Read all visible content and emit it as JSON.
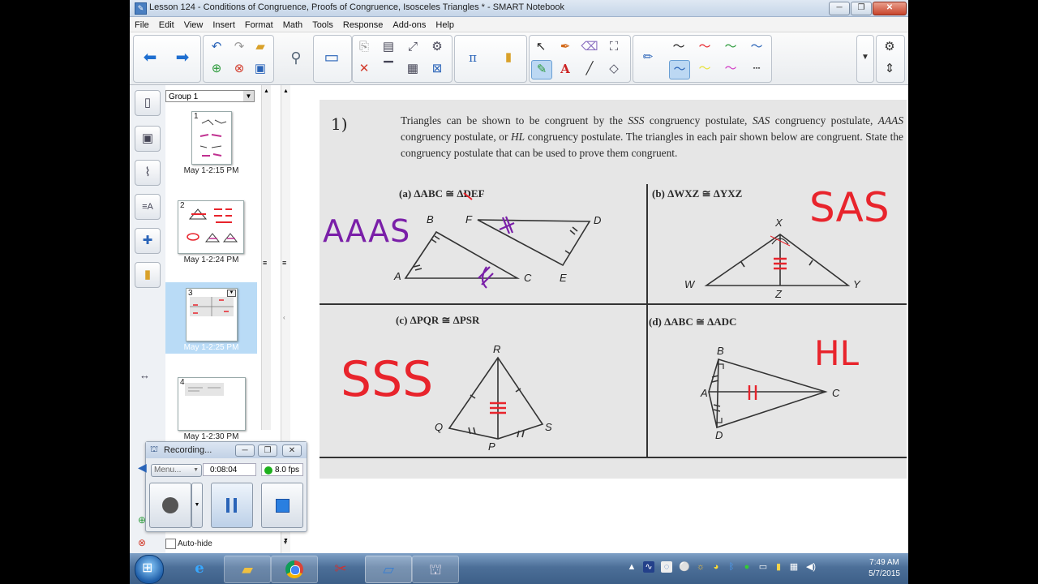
{
  "window": {
    "title": "Lesson 124 - Conditions of Congruence, Proofs of Congruence, Isosceles Triangles * - SMART Notebook",
    "min": "─",
    "max": "❐",
    "close": "✕"
  },
  "menu": [
    "File",
    "Edit",
    "View",
    "Insert",
    "Format",
    "Math",
    "Tools",
    "Response",
    "Add-ons",
    "Help"
  ],
  "sorter": {
    "group_label": "Group 1",
    "pages": [
      {
        "num": "1",
        "time": "May 1-2:15 PM",
        "selected": false
      },
      {
        "num": "2",
        "time": "May 1-2:24 PM",
        "selected": false
      },
      {
        "num": "3",
        "time": "May 1-2:25 PM",
        "selected": true
      },
      {
        "num": "4",
        "time": "May 1-2:30 PM",
        "selected": false
      }
    ]
  },
  "recorder": {
    "title": "Recording...",
    "menu_label": "Menu...",
    "time": "0:08:04",
    "fps": "8.0 fps",
    "autohide": "Auto-hide"
  },
  "worksheet": {
    "problem_number": "1)",
    "intro_parts": [
      "Triangles can be shown to be congruent by the ",
      "SSS",
      " congruency postulate, ",
      "SAS",
      " congruency postulate, ",
      "AAAS",
      " congruency postulate, or ",
      "HL",
      " congruency postulate. The triangles in each pair shown below are congruent. State the congruency postulate that can be used to prove them congruent."
    ],
    "parts": [
      {
        "label": "(a) ΔABC ≅ ΔDEF",
        "answer": "AAAS",
        "vertices": [
          "B",
          "F",
          "D",
          "A",
          "C",
          "E"
        ]
      },
      {
        "label": "(b) ΔWXZ ≅ ΔYXZ",
        "answer": "SAS",
        "vertices": [
          "X",
          "W",
          "Z",
          "Y"
        ]
      },
      {
        "label": "(c) ΔPQR ≅ ΔPSR",
        "answer": "SSS",
        "vertices": [
          "R",
          "Q",
          "P",
          "S"
        ]
      },
      {
        "label": "(d) ΔABC ≅ ΔADC",
        "answer": "HL",
        "vertices": [
          "B",
          "A",
          "C",
          "D"
        ]
      }
    ]
  },
  "taskbar": {
    "time": "7:49 AM",
    "date": "5/7/2015"
  },
  "colors": {
    "ink_red": "#e8242c",
    "ink_purple": "#7a1fa8",
    "selected_page": "#b9dbf6"
  }
}
